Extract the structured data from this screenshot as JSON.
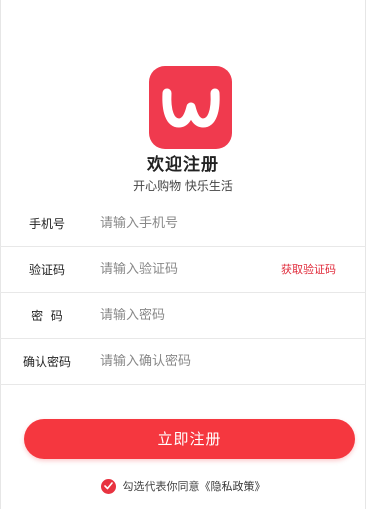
{
  "app": {
    "logo_letter": "W",
    "welcome": "欢迎注册",
    "slogan": "开心购物 快乐生活"
  },
  "form": {
    "fields": [
      {
        "label": "手机号",
        "placeholder": "请输入手机号"
      },
      {
        "label": "验证码",
        "placeholder": "请输入验证码"
      },
      {
        "label": "密  码",
        "placeholder": "请输入密码"
      },
      {
        "label": "确认密码",
        "placeholder": "请输入确认密码"
      }
    ],
    "get_code_label": "获取验证码",
    "submit_label": "立即注册"
  },
  "agreement": {
    "checked": true,
    "text": "勾选代表你同意",
    "policy_link": "《隐私政策》"
  },
  "colors": {
    "brand": "#f03a4e",
    "button": "#f5373f",
    "link": "#e02a3a"
  },
  "icons": {
    "logo": "w-logo-icon",
    "checkbox": "checkmark-icon"
  }
}
